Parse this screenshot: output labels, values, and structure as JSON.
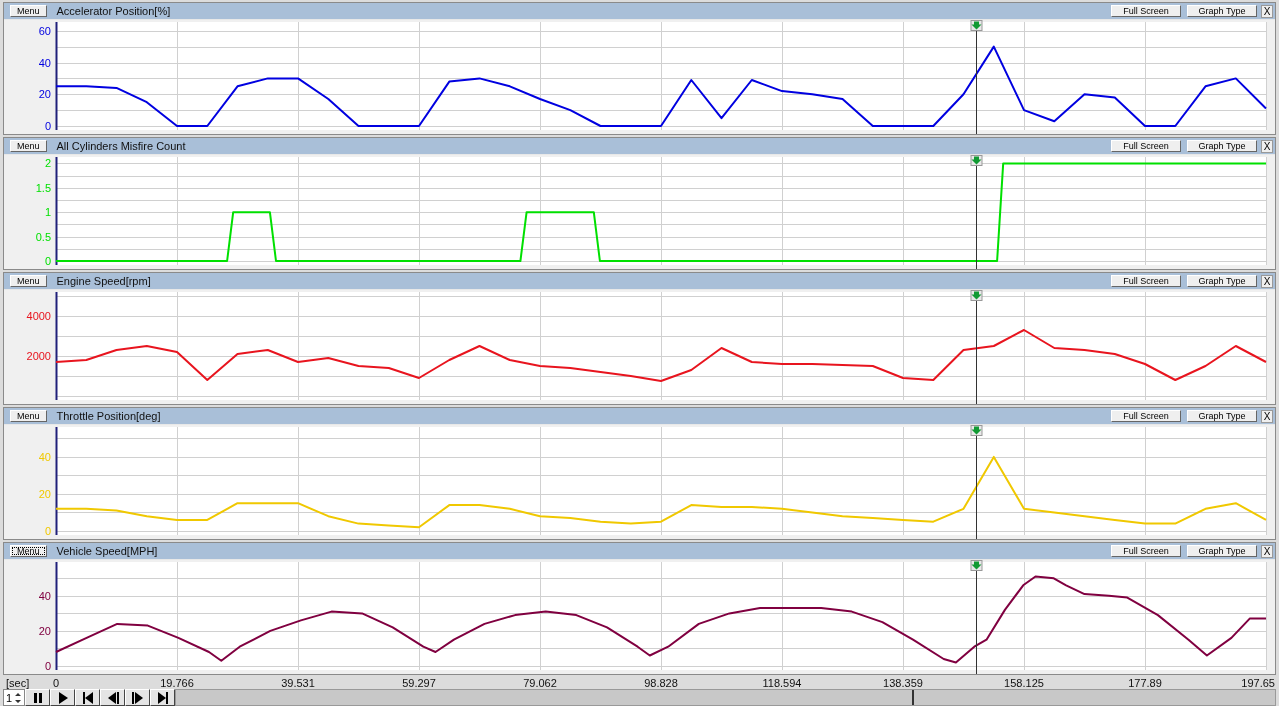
{
  "panels": [
    {
      "menu_button": "Menu",
      "menu_focused": false,
      "title": "Accelerator Position[%]",
      "buttons": [
        "Full Screen",
        "Graph Type"
      ],
      "close": "X",
      "chart_data": {
        "type": "line",
        "grid": true,
        "ylim": [
          0,
          63
        ],
        "yticks": [
          0,
          20,
          40,
          60
        ],
        "categories": [
          null,
          null,
          null,
          null,
          null,
          null,
          null,
          null,
          null,
          null,
          null,
          null,
          null,
          null,
          null,
          null,
          null,
          null,
          null,
          null,
          null,
          null,
          null,
          null,
          null,
          null,
          null,
          null,
          null,
          null,
          null,
          null,
          null,
          null,
          null,
          null,
          null,
          null,
          null,
          null,
          null
        ],
        "series": [
          {
            "color": "#0000e0",
            "values": [
              25,
              25,
              24,
              15,
              0,
              0,
              25,
              30,
              30,
              17,
              0,
              0,
              0,
              28,
              30,
              25,
              17,
              10,
              0,
              0,
              0,
              29,
              5,
              29,
              22,
              20,
              17,
              0,
              0,
              0,
              20,
              50,
              10,
              3,
              20,
              18,
              0,
              0,
              25,
              30,
              11
            ]
          }
        ]
      }
    },
    {
      "menu_button": "Menu",
      "menu_focused": false,
      "title": "All Cylinders Misfire Count",
      "buttons": [
        "Full Screen",
        "Graph Type"
      ],
      "close": "X",
      "chart_data": {
        "type": "line",
        "grid": true,
        "ylim": [
          0,
          2.05
        ],
        "yticks": [
          0,
          0.5,
          1,
          1.5,
          2
        ],
        "categories": [
          null,
          null,
          null,
          null,
          null,
          null,
          null,
          null,
          null,
          null,
          null,
          null,
          null,
          null,
          null,
          null,
          null,
          null,
          null,
          null,
          null,
          null,
          null,
          null,
          null,
          null,
          null,
          null,
          null,
          null,
          null,
          null,
          null,
          null,
          null,
          null,
          null,
          null,
          null,
          null,
          null,
          null,
          null,
          null,
          null,
          null,
          null,
          null,
          null,
          null,
          null,
          null,
          null,
          null,
          null,
          null,
          null,
          null,
          null,
          null,
          null,
          null,
          null,
          null,
          null,
          null,
          null,
          null,
          null,
          null,
          null,
          null,
          null,
          null,
          null,
          null,
          null,
          null,
          null,
          null,
          null,
          null,
          null,
          null,
          null,
          null,
          null,
          null,
          null,
          null,
          null,
          null,
          null,
          null,
          null,
          null,
          null,
          null,
          null,
          null,
          null,
          null,
          null,
          null,
          null,
          null,
          null,
          null,
          null,
          null,
          null,
          null,
          null,
          null,
          null,
          null,
          null,
          null,
          null,
          null,
          null,
          null,
          null,
          null,
          null,
          null,
          null,
          null,
          null,
          null,
          null,
          null,
          null,
          null,
          null,
          null,
          null,
          null,
          null,
          null,
          null,
          null,
          null,
          null,
          null,
          null,
          null,
          null,
          null,
          null,
          null,
          null,
          null,
          null,
          null,
          null,
          null,
          null,
          null,
          null,
          null,
          null,
          null,
          null,
          null,
          null,
          null,
          null,
          null,
          null,
          null,
          null,
          null,
          null,
          null,
          null,
          null,
          null,
          null,
          null,
          null,
          null,
          null,
          null,
          null,
          null,
          null,
          null,
          null,
          null,
          null,
          null,
          null,
          null,
          null,
          null,
          null,
          null,
          null
        ],
        "series": [
          {
            "color": "#00e000",
            "values": [
              0,
              0,
              0,
              0,
              0,
              0,
              0,
              0,
              0,
              0,
              0,
              0,
              0,
              0,
              0,
              0,
              0,
              0,
              0,
              0,
              0,
              0,
              0,
              0,
              0,
              0,
              0,
              0,
              0,
              1,
              1,
              1,
              1,
              1,
              1,
              1,
              0,
              0,
              0,
              0,
              0,
              0,
              0,
              0,
              0,
              0,
              0,
              0,
              0,
              0,
              0,
              0,
              0,
              0,
              0,
              0,
              0,
              0,
              0,
              0,
              0,
              0,
              0,
              0,
              0,
              0,
              0,
              0,
              0,
              0,
              0,
              0,
              0,
              0,
              0,
              0,
              0,
              1,
              1,
              1,
              1,
              1,
              1,
              1,
              1,
              1,
              1,
              1,
              1,
              0,
              0,
              0,
              0,
              0,
              0,
              0,
              0,
              0,
              0,
              0,
              0,
              0,
              0,
              0,
              0,
              0,
              0,
              0,
              0,
              0,
              0,
              0,
              0,
              0,
              0,
              0,
              0,
              0,
              0,
              0,
              0,
              0,
              0,
              0,
              0,
              0,
              0,
              0,
              0,
              0,
              0,
              0,
              0,
              0,
              0,
              0,
              0,
              0,
              0,
              0,
              0,
              0,
              0,
              0,
              0,
              0,
              0,
              0,
              0,
              0,
              0,
              0,
              0,
              0,
              0,
              2,
              2,
              2,
              2,
              2,
              2,
              2,
              2,
              2,
              2,
              2,
              2,
              2,
              2,
              2,
              2,
              2,
              2,
              2,
              2,
              2,
              2,
              2,
              2,
              2,
              2,
              2,
              2,
              2,
              2,
              2,
              2,
              2,
              2,
              2,
              2,
              2,
              2,
              2,
              2,
              2,
              2,
              2,
              2
            ]
          }
        ]
      }
    },
    {
      "menu_button": "Menu",
      "menu_focused": false,
      "title": "Engine Speed[rpm]",
      "buttons": [
        "Full Screen",
        "Graph Type"
      ],
      "close": "X",
      "chart_data": {
        "type": "line",
        "grid": true,
        "ylim": [
          0,
          5000
        ],
        "yticks": [
          2000,
          4000
        ],
        "categories": [
          null,
          null,
          null,
          null,
          null,
          null,
          null,
          null,
          null,
          null,
          null,
          null,
          null,
          null,
          null,
          null,
          null,
          null,
          null,
          null,
          null,
          null,
          null,
          null,
          null,
          null,
          null,
          null,
          null,
          null,
          null,
          null,
          null,
          null,
          null,
          null,
          null,
          null,
          null,
          null,
          null
        ],
        "series": [
          {
            "color": "#e8141e",
            "values": [
              1700,
              1800,
              2300,
              2500,
              2200,
              800,
              2100,
              2300,
              1700,
              1900,
              1500,
              1400,
              900,
              1800,
              2500,
              1800,
              1500,
              1400,
              1200,
              1000,
              750,
              1300,
              2400,
              1700,
              1600,
              1600,
              1550,
              1500,
              900,
              800,
              2300,
              2500,
              3300,
              2400,
              2300,
              2100,
              1600,
              800,
              1500,
              2500,
              1700
            ]
          }
        ]
      }
    },
    {
      "menu_button": "Menu",
      "menu_focused": false,
      "title": "Throttle Position[deg]",
      "buttons": [
        "Full Screen",
        "Graph Type"
      ],
      "close": "X",
      "chart_data": {
        "type": "line",
        "grid": true,
        "ylim": [
          0,
          54
        ],
        "yticks": [
          0,
          20,
          40
        ],
        "categories": [
          null,
          null,
          null,
          null,
          null,
          null,
          null,
          null,
          null,
          null,
          null,
          null,
          null,
          null,
          null,
          null,
          null,
          null,
          null,
          null,
          null,
          null,
          null,
          null,
          null,
          null,
          null,
          null,
          null,
          null,
          null,
          null,
          null,
          null,
          null,
          null,
          null,
          null,
          null,
          null,
          null
        ],
        "series": [
          {
            "color": "#f0c800",
            "values": [
              12,
              12,
              11,
              8,
              6,
              6,
              15,
              15,
              15,
              8,
              4,
              3,
              2,
              14,
              14,
              12,
              8,
              7,
              5,
              4,
              5,
              14,
              13,
              13,
              12,
              10,
              8,
              7,
              6,
              5,
              12,
              40,
              12,
              10,
              8,
              6,
              4,
              4,
              12,
              15,
              6
            ]
          }
        ]
      }
    },
    {
      "menu_button": "Menu",
      "menu_focused": true,
      "title": "Vehicle Speed[MPH]",
      "buttons": [
        "Full Screen",
        "Graph Type"
      ],
      "close": "X",
      "chart_data": {
        "type": "line",
        "grid": true,
        "xlim": [
          0,
          197.656
        ],
        "ylim": [
          0,
          57
        ],
        "ref_lines": [
          {
            "axis": "x",
            "value": 150.3
          }
        ],
        "yticks": [
          0,
          20,
          40
        ],
        "x": [
          0,
          5,
          10,
          15,
          20,
          25,
          27,
          30,
          35,
          40,
          45,
          50,
          55,
          60,
          62,
          65,
          70,
          75,
          80,
          85,
          90,
          95,
          97,
          100,
          105,
          110,
          115,
          120,
          125,
          130,
          135,
          140,
          145,
          147,
          150,
          152,
          155,
          158,
          160,
          163,
          165,
          168,
          172,
          175,
          180,
          185,
          188,
          192,
          195,
          197.656
        ],
        "series": [
          {
            "color": "#800040",
            "values": [
              8,
              16,
              24,
              23,
              16,
              8,
              3,
              11,
              20,
              26,
              31,
              30,
              22,
              11,
              8,
              15,
              24,
              29,
              31,
              29,
              22,
              11,
              6,
              11,
              24,
              30,
              33,
              33,
              33,
              31,
              25,
              15,
              4,
              2,
              11,
              15,
              32,
              46,
              51,
              50,
              46,
              41,
              40,
              39,
              29,
              15,
              6,
              16,
              27,
              27
            ]
          }
        ],
        "xlabel": "[sec]",
        "xticks": [
          0,
          19.766,
          39.531,
          59.297,
          79.062,
          98.828,
          118.594,
          138.359,
          158.125,
          177.89,
          197.65
        ]
      }
    }
  ],
  "playback": {
    "speed": "1"
  }
}
